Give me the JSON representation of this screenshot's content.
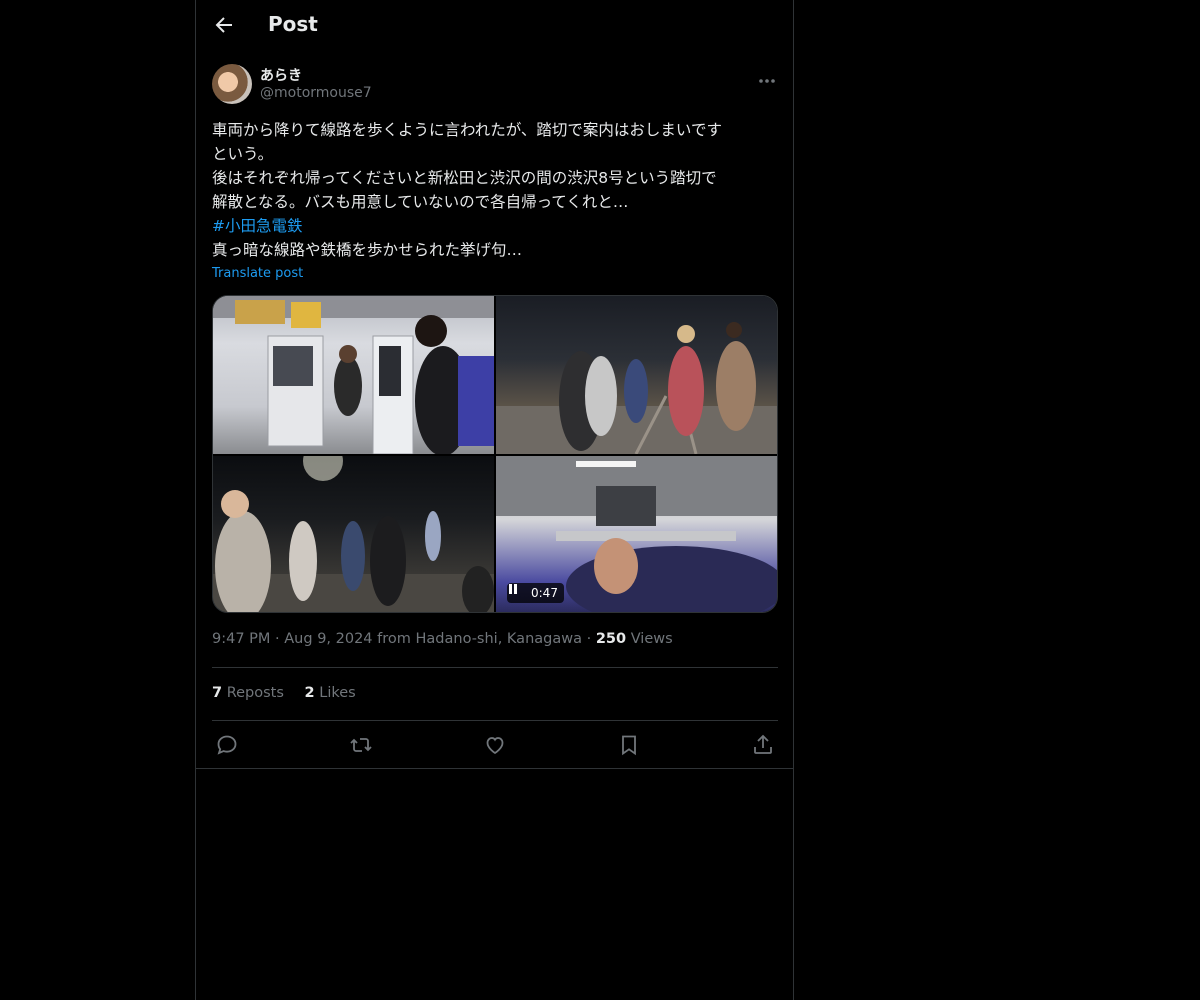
{
  "header": {
    "title": "Post",
    "back_icon": "arrow-left-icon"
  },
  "author": {
    "name": "あらき",
    "handle": "@motormouse7",
    "more_icon": "ellipsis-icon"
  },
  "post": {
    "lines": [
      "車両から降りて線路を歩くように言われたが、踏切で案内はおしまいです",
      "という。",
      "後はそれぞれ帰ってくださいと新松田と渋沢の間の渋沢8号という踏切で",
      "解散となる。バスも用意していないので各自帰ってくれと…"
    ],
    "hashtag": "#小田急電鉄",
    "last_line": "真っ暗な線路や鉄橋を歩かせられた挙げ句…",
    "translate_label": "Translate post"
  },
  "media": {
    "video_time": "0:47"
  },
  "meta": {
    "time": "9:47 PM",
    "sep": "·",
    "date_location": "Aug 9, 2024 from Hadano-shi, Kanagawa",
    "views_count": "250",
    "views_label": "Views"
  },
  "stats": {
    "reposts_count": "7",
    "reposts_label": "Reposts",
    "likes_count": "2",
    "likes_label": "Likes"
  },
  "actions": [
    "reply-icon",
    "repost-icon",
    "like-icon",
    "bookmark-icon",
    "share-icon"
  ],
  "colors": {
    "background": "#000000",
    "text": "#e7e9ea",
    "muted": "#71767b",
    "accent": "#1d9bf0",
    "border": "#2f3336"
  }
}
